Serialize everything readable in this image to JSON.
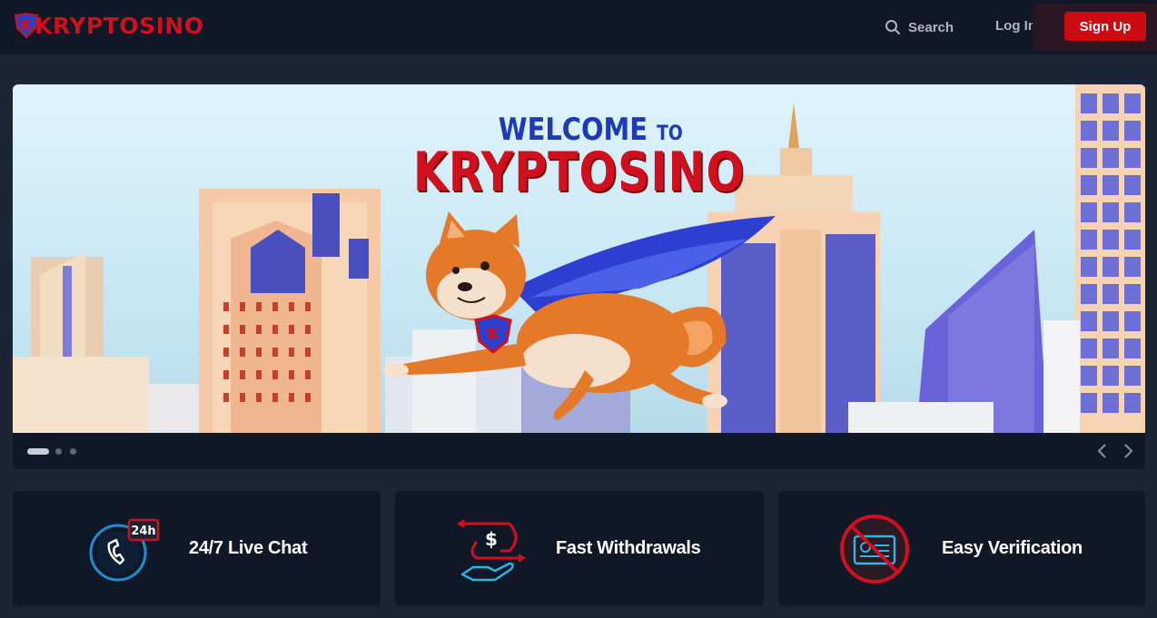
{
  "header": {
    "logo_text": "KRYPTOSINO",
    "logo_badge": "K",
    "search_label": "Search",
    "login_label": "Log In",
    "signup_label": "Sign Up"
  },
  "hero": {
    "title_line1": "WELCOME",
    "title_line1_small": "TO",
    "title_line2": "KRYPTOSINO",
    "badge_letter": "K",
    "slides": [
      {
        "active": true
      },
      {
        "active": false
      },
      {
        "active": false
      }
    ]
  },
  "features": [
    {
      "label": "24/7 Live Chat",
      "icon": "live-chat-24h-icon",
      "icon_text": "24h"
    },
    {
      "label": "Fast Withdrawals",
      "icon": "fast-withdrawal-icon",
      "icon_text": "$"
    },
    {
      "label": "Easy Verification",
      "icon": "no-id-verification-icon"
    }
  ],
  "colors": {
    "brand_red": "#cc0a12",
    "brand_blue": "#1d3bb8",
    "header_bg": "#111827",
    "page_bg": "#1c2536",
    "card_bg": "#101726"
  }
}
